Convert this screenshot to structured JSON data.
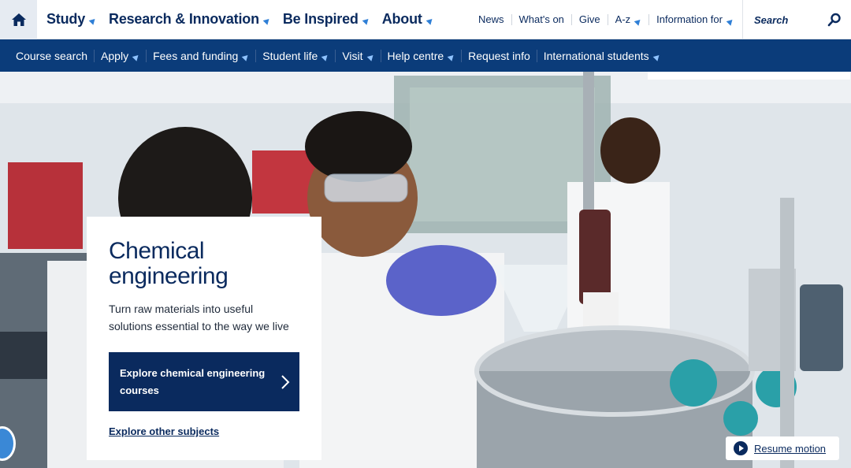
{
  "primary_nav": [
    {
      "label": "Study"
    },
    {
      "label": "Research & Innovation"
    },
    {
      "label": "Be Inspired"
    },
    {
      "label": "About"
    }
  ],
  "utility_nav": [
    {
      "label": "News",
      "has_menu": false
    },
    {
      "label": "What's on",
      "has_menu": false
    },
    {
      "label": "Give",
      "has_menu": false
    },
    {
      "label": "A-z",
      "has_menu": true
    },
    {
      "label": "Information for",
      "has_menu": true
    }
  ],
  "search": {
    "placeholder": "Search"
  },
  "secondary_nav": [
    {
      "label": "Course search",
      "has_menu": false
    },
    {
      "label": "Apply",
      "has_menu": true
    },
    {
      "label": "Fees and funding",
      "has_menu": true
    },
    {
      "label": "Student life",
      "has_menu": true
    },
    {
      "label": "Visit",
      "has_menu": true
    },
    {
      "label": "Help centre",
      "has_menu": true
    },
    {
      "label": "Request info",
      "has_menu": false
    },
    {
      "label": "International students",
      "has_menu": true
    }
  ],
  "hero": {
    "title_line1": "Chemical",
    "title_line2": "engineering",
    "description": "Turn raw materials into useful solutions essential to the way we live",
    "cta_label": "Explore chemical engineering courses",
    "secondary_link": "Explore other subjects"
  },
  "resume": {
    "label": "Resume motion"
  },
  "colors": {
    "navy": "#0a2a5e",
    "subnav_bg": "#0b3c7a",
    "accent_blue": "#2f7fd6"
  },
  "icons": {
    "home": "home-icon",
    "search": "search-icon",
    "chevron": "chevron-right-icon",
    "play": "play-icon"
  }
}
